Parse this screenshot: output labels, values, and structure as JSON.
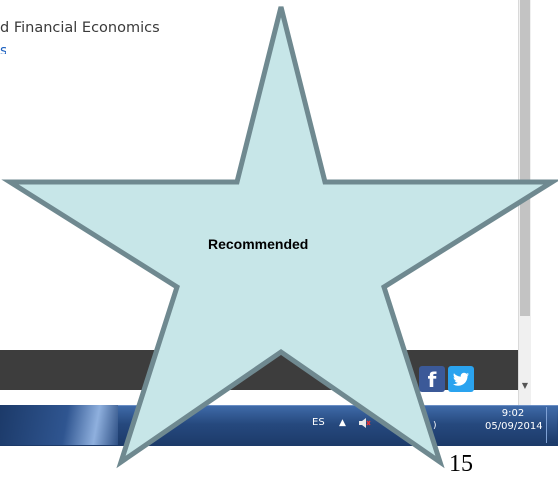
{
  "page": {
    "heading_fragment": "d Financial Economics",
    "link_fragment": "s"
  },
  "social": {
    "facebook_label": "f"
  },
  "taskbar": {
    "language": "ES",
    "tray_arrow": "▲",
    "tray_partial": ")",
    "clock_time": "9:02",
    "clock_date": "05/09/2014"
  },
  "star": {
    "label": "Recommended",
    "fill_color": "#c7e6e8",
    "stroke_color": "#6f8990"
  },
  "slide": {
    "number": "15"
  },
  "colors": {
    "footer_bar": "#3d3d3d",
    "facebook": "#3b5998",
    "twitter": "#2aa3ef",
    "taskbar": "#26497e"
  }
}
